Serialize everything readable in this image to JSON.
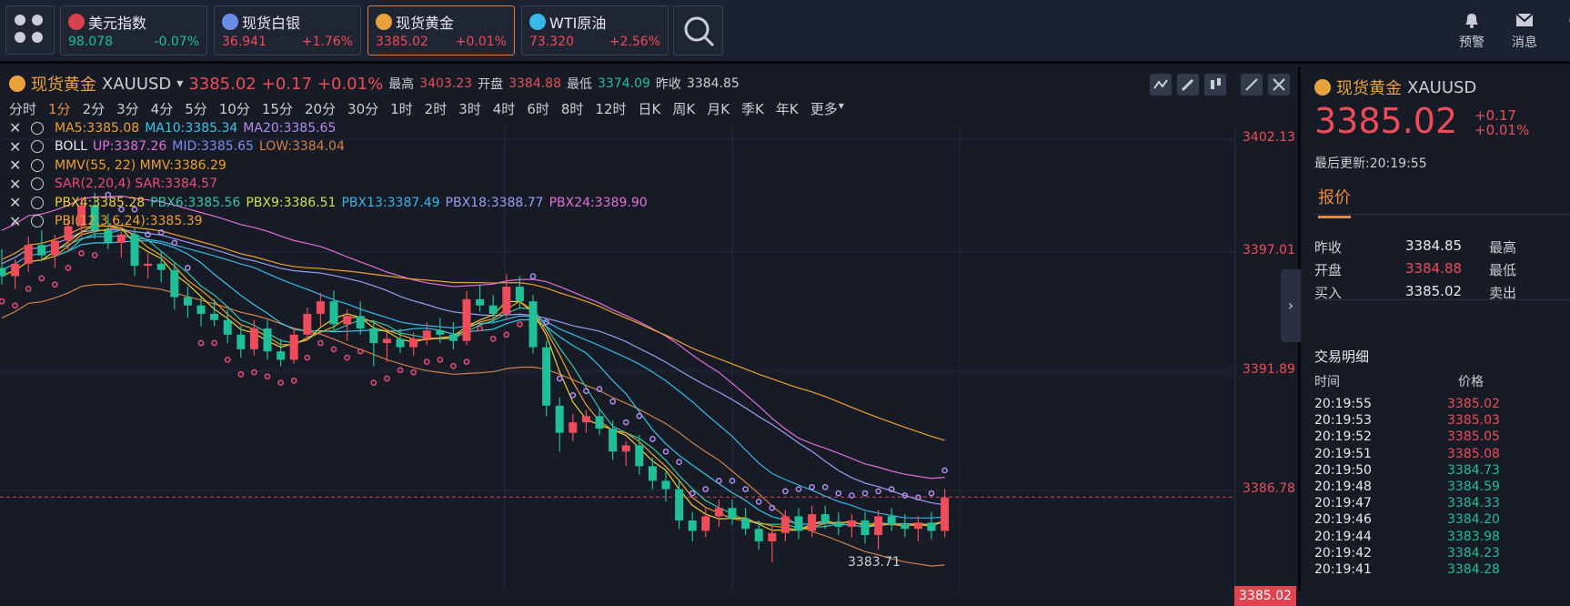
{
  "tickers": [
    {
      "name": "美元指数",
      "price": "98.078",
      "change": "-0.07%",
      "price_color": "#1fbf98",
      "change_color": "#1fbf98",
      "flag": "us-flag-icon"
    },
    {
      "name": "现货白银",
      "price": "36.941",
      "change": "+1.76%",
      "price_color": "#ee4c5a",
      "change_color": "#ee4c5a",
      "flag": "silver-icon"
    },
    {
      "name": "现货黄金",
      "price": "3385.02",
      "change": "+0.01%",
      "price_color": "#ee4c5a",
      "change_color": "#ee4c5a",
      "flag": "gold-icon"
    },
    {
      "name": "WTI原油",
      "price": "73.320",
      "change": "+2.56%",
      "price_color": "#ee4c5a",
      "change_color": "#ee4c5a",
      "flag": "oil-icon"
    }
  ],
  "top_icons": [
    {
      "label": "预警",
      "icon": "bell-icon"
    },
    {
      "label": "消息",
      "icon": "mail-icon"
    },
    {
      "label": "客",
      "icon": "service-icon"
    }
  ],
  "chart_header": {
    "name": "现货黄金",
    "symbol": "XAUUSD",
    "price": "3385.02",
    "change": "+0.17",
    "pct": "+0.01%",
    "high_label": "最高",
    "high": "3403.23",
    "open_label": "开盘",
    "open": "3384.88",
    "low_label": "最低",
    "low": "3374.09",
    "prev_label": "昨收",
    "prev": "3384.85"
  },
  "timeframes": [
    "分时",
    "1分",
    "2分",
    "3分",
    "4分",
    "5分",
    "10分",
    "15分",
    "20分",
    "30分",
    "1时",
    "2时",
    "3时",
    "4时",
    "6时",
    "8时",
    "12时",
    "日K",
    "周K",
    "月K",
    "季K",
    "年K",
    "更多"
  ],
  "selected_timeframe": "1分",
  "indicators": [
    [
      {
        "t": "MA5:3385.08",
        "c": "#f0a030"
      },
      {
        "t": "MA10:3385.34",
        "c": "#38c6e8"
      },
      {
        "t": "MA20:3385.65",
        "c": "#b28cf0"
      }
    ],
    [
      {
        "t": "BOLL",
        "c": "#e6e9ef"
      },
      {
        "t": "UP:3387.26",
        "c": "#e070d8"
      },
      {
        "t": "MID:3385.65",
        "c": "#7f8cf0"
      },
      {
        "t": "LOW:3384.04",
        "c": "#d08048"
      }
    ],
    [
      {
        "t": "MMV(55, 22) MMV:3386.29",
        "c": "#f0a030"
      }
    ],
    [
      {
        "t": "SAR(2,20,4) SAR:3384.57",
        "c": "#ee4c78"
      }
    ],
    [
      {
        "t": "PBX4:3385.28",
        "c": "#f0d030"
      },
      {
        "t": "PBX6:3385.56",
        "c": "#38c6a8"
      },
      {
        "t": "PBX9:3386.51",
        "c": "#d0e050"
      },
      {
        "t": "PBX13:3387.49",
        "c": "#38b8e8"
      },
      {
        "t": "PBX18:3388.77",
        "c": "#9a9ef0"
      },
      {
        "t": "PBX24:3389.90",
        "c": "#e070d8"
      }
    ],
    [
      {
        "t": "PBI(12,3,6,24):3385.39",
        "c": "#f0a030"
      }
    ]
  ],
  "chart_data": {
    "type": "candlestick",
    "y_ticks": [
      "3402.13",
      "3397.01",
      "3391.89",
      "3386.78"
    ],
    "ylim": [
      3380.5,
      3402.6
    ],
    "current_price": "3385.02",
    "min_label": "3383.71",
    "ohlc": [
      [
        3396.0,
        3396.9,
        3395.2,
        3395.6
      ],
      [
        3395.6,
        3396.4,
        3395.0,
        3396.2
      ],
      [
        3396.2,
        3397.5,
        3395.8,
        3397.1
      ],
      [
        3397.1,
        3397.8,
        3396.3,
        3396.6
      ],
      [
        3396.6,
        3397.6,
        3396.0,
        3397.3
      ],
      [
        3397.3,
        3398.4,
        3396.8,
        3398.0
      ],
      [
        3398.0,
        3399.4,
        3397.5,
        3399.0
      ],
      [
        3399.0,
        3399.6,
        3397.4,
        3397.8
      ],
      [
        3397.8,
        3398.6,
        3396.9,
        3397.2
      ],
      [
        3397.2,
        3397.9,
        3396.5,
        3397.6
      ],
      [
        3397.6,
        3397.9,
        3395.6,
        3396.1
      ],
      [
        3396.1,
        3396.7,
        3395.5,
        3396.2
      ],
      [
        3396.2,
        3396.8,
        3395.3,
        3395.9
      ],
      [
        3395.9,
        3396.3,
        3394.0,
        3394.6
      ],
      [
        3394.6,
        3395.1,
        3393.6,
        3394.2
      ],
      [
        3394.2,
        3394.6,
        3393.2,
        3393.8
      ],
      [
        3393.8,
        3394.5,
        3393.2,
        3393.5
      ],
      [
        3393.5,
        3394.0,
        3392.4,
        3392.8
      ],
      [
        3392.8,
        3393.2,
        3391.7,
        3392.1
      ],
      [
        3392.1,
        3393.5,
        3391.8,
        3393.1
      ],
      [
        3393.1,
        3393.5,
        3391.6,
        3392.0
      ],
      [
        3392.0,
        3392.6,
        3391.3,
        3391.6
      ],
      [
        3391.6,
        3393.1,
        3391.4,
        3392.8
      ],
      [
        3392.8,
        3394.1,
        3392.5,
        3393.8
      ],
      [
        3393.8,
        3394.8,
        3393.2,
        3394.4
      ],
      [
        3394.4,
        3394.9,
        3392.9,
        3393.3
      ],
      [
        3393.3,
        3394.0,
        3392.5,
        3393.7
      ],
      [
        3393.7,
        3394.4,
        3392.8,
        3393.1
      ],
      [
        3393.1,
        3393.5,
        3391.3,
        3392.4
      ],
      [
        3392.4,
        3392.9,
        3391.5,
        3392.6
      ],
      [
        3392.6,
        3393.1,
        3391.9,
        3392.2
      ],
      [
        3392.2,
        3392.9,
        3391.8,
        3392.6
      ],
      [
        3392.6,
        3393.4,
        3392.3,
        3393.0
      ],
      [
        3393.0,
        3393.6,
        3392.4,
        3392.8
      ],
      [
        3392.8,
        3393.4,
        3392.1,
        3392.5
      ],
      [
        3392.5,
        3394.9,
        3392.3,
        3394.5
      ],
      [
        3394.5,
        3395.2,
        3393.9,
        3394.2
      ],
      [
        3394.2,
        3394.7,
        3393.4,
        3393.8
      ],
      [
        3393.8,
        3395.7,
        3393.6,
        3395.1
      ],
      [
        3395.1,
        3395.6,
        3394.1,
        3394.4
      ],
      [
        3394.4,
        3394.7,
        3391.9,
        3392.2
      ],
      [
        3392.2,
        3392.5,
        3388.9,
        3389.4
      ],
      [
        3389.4,
        3389.8,
        3387.2,
        3388.1
      ],
      [
        3388.1,
        3389.0,
        3387.7,
        3388.6
      ],
      [
        3388.6,
        3389.2,
        3388.1,
        3388.9
      ],
      [
        3388.9,
        3389.3,
        3388.0,
        3388.3
      ],
      [
        3388.3,
        3388.7,
        3386.8,
        3387.2
      ],
      [
        3387.2,
        3387.7,
        3386.5,
        3387.5
      ],
      [
        3387.5,
        3388.0,
        3386.1,
        3386.5
      ],
      [
        3386.5,
        3386.9,
        3385.4,
        3385.8
      ],
      [
        3385.8,
        3386.3,
        3384.8,
        3385.4
      ],
      [
        3385.4,
        3385.8,
        3383.5,
        3383.9
      ],
      [
        3383.9,
        3384.3,
        3382.9,
        3383.4
      ],
      [
        3383.4,
        3384.5,
        3383.1,
        3384.1
      ],
      [
        3384.1,
        3384.9,
        3383.6,
        3384.5
      ],
      [
        3384.5,
        3384.9,
        3383.7,
        3384.0
      ],
      [
        3384.0,
        3384.5,
        3383.2,
        3383.5
      ],
      [
        3383.5,
        3383.9,
        3382.5,
        3382.9
      ],
      [
        3382.9,
        3383.6,
        3381.9,
        3383.3
      ],
      [
        3383.3,
        3384.4,
        3382.9,
        3384.1
      ],
      [
        3384.1,
        3384.5,
        3383.0,
        3383.4
      ],
      [
        3383.4,
        3384.6,
        3383.1,
        3384.2
      ],
      [
        3384.2,
        3384.6,
        3383.5,
        3383.8
      ],
      [
        3383.8,
        3384.3,
        3383.2,
        3383.6
      ],
      [
        3383.6,
        3384.2,
        3383.1,
        3383.9
      ],
      [
        3383.9,
        3384.3,
        3382.8,
        3383.2
      ],
      [
        3383.2,
        3384.4,
        3382.5,
        3384.1
      ],
      [
        3384.1,
        3384.5,
        3383.4,
        3383.7
      ],
      [
        3383.7,
        3384.2,
        3383.1,
        3383.5
      ],
      [
        3383.5,
        3384.1,
        3382.9,
        3383.8
      ],
      [
        3383.8,
        3384.3,
        3383.0,
        3383.4
      ],
      [
        3383.4,
        3385.4,
        3383.1,
        3385.0
      ]
    ]
  },
  "side": {
    "name": "现货黄金",
    "symbol": "XAUUSD",
    "price": "3385.02",
    "change": "+0.17",
    "pct": "+0.01%",
    "update_label": "最后更新:",
    "update_time": "20:19:55",
    "tab": "报价",
    "rows": [
      {
        "k": "昨收",
        "v": "3384.85",
        "vc": "#e6e9ef",
        "k2": "最高"
      },
      {
        "k": "开盘",
        "v": "3384.88",
        "vc": "#ee4c5a",
        "k2": "最低"
      },
      {
        "k": "买入",
        "v": "3385.02",
        "vc": "#e6e9ef",
        "k2": "卖出"
      }
    ],
    "trades_title": "交易明细",
    "col_time": "时间",
    "col_price": "价格",
    "trades": [
      {
        "t": "20:19:55",
        "p": "3385.02",
        "c": "#ee4c5a"
      },
      {
        "t": "20:19:53",
        "p": "3385.03",
        "c": "#ee4c5a"
      },
      {
        "t": "20:19:52",
        "p": "3385.05",
        "c": "#ee4c5a"
      },
      {
        "t": "20:19:51",
        "p": "3385.08",
        "c": "#ee4c5a"
      },
      {
        "t": "20:19:50",
        "p": "3384.73",
        "c": "#1fbf98"
      },
      {
        "t": "20:19:48",
        "p": "3384.59",
        "c": "#1fbf98"
      },
      {
        "t": "20:19:47",
        "p": "3384.33",
        "c": "#1fbf98"
      },
      {
        "t": "20:19:46",
        "p": "3384.20",
        "c": "#1fbf98"
      },
      {
        "t": "20:19:44",
        "p": "3383.98",
        "c": "#1fbf98"
      },
      {
        "t": "20:19:42",
        "p": "3384.23",
        "c": "#1fbf98"
      },
      {
        "t": "20:19:41",
        "p": "3384.28",
        "c": "#1fbf98"
      }
    ]
  }
}
